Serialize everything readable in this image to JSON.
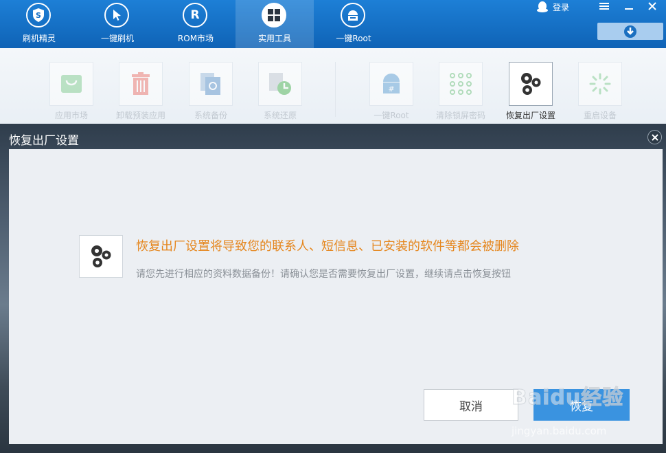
{
  "topbar": {
    "tabs": [
      {
        "label": "刷机精灵",
        "icon": "shield-s-icon"
      },
      {
        "label": "一键刷机",
        "icon": "cursor-arrow-icon"
      },
      {
        "label": "ROM市场",
        "icon": "r-letter-icon"
      },
      {
        "label": "实用工具",
        "icon": "four-squares-icon",
        "active": true
      },
      {
        "label": "一键Root",
        "icon": "android-root-icon"
      }
    ],
    "login_label": "登录",
    "login_icon": "qq-penguin-icon"
  },
  "toolstrip": {
    "tools": [
      {
        "label": "应用市场",
        "icon": "bag-icon"
      },
      {
        "label": "卸载预装应用",
        "icon": "trash-icon"
      },
      {
        "label": "系统备份",
        "icon": "backup-icon"
      },
      {
        "label": "系统还原",
        "icon": "restore-icon"
      },
      {
        "label": "一键Root",
        "icon": "android-root-icon"
      },
      {
        "label": "清除锁屏密码",
        "icon": "pattern-lock-icon"
      },
      {
        "label": "恢复出厂设置",
        "icon": "gears-icon",
        "selected": true
      },
      {
        "label": "重启设备",
        "icon": "spinner-icon"
      }
    ]
  },
  "dialog": {
    "title": "恢复出厂设置",
    "warning_title": "恢复出厂设置将导致您的联系人、短信息、已安装的软件等都会被删除",
    "warning_sub": "请您先进行相应的资料数据备份！请确认您是否需要恢复出厂设置，继续请点击恢复按钮",
    "cancel_label": "取消",
    "restore_label": "恢复"
  },
  "watermark": {
    "main": "Baidu经验",
    "url": "jingyan.baidu.com"
  },
  "colors": {
    "topbar_blue": "#1670c6",
    "warning_orange": "#e5861d",
    "primary_button": "#3a93e0"
  }
}
